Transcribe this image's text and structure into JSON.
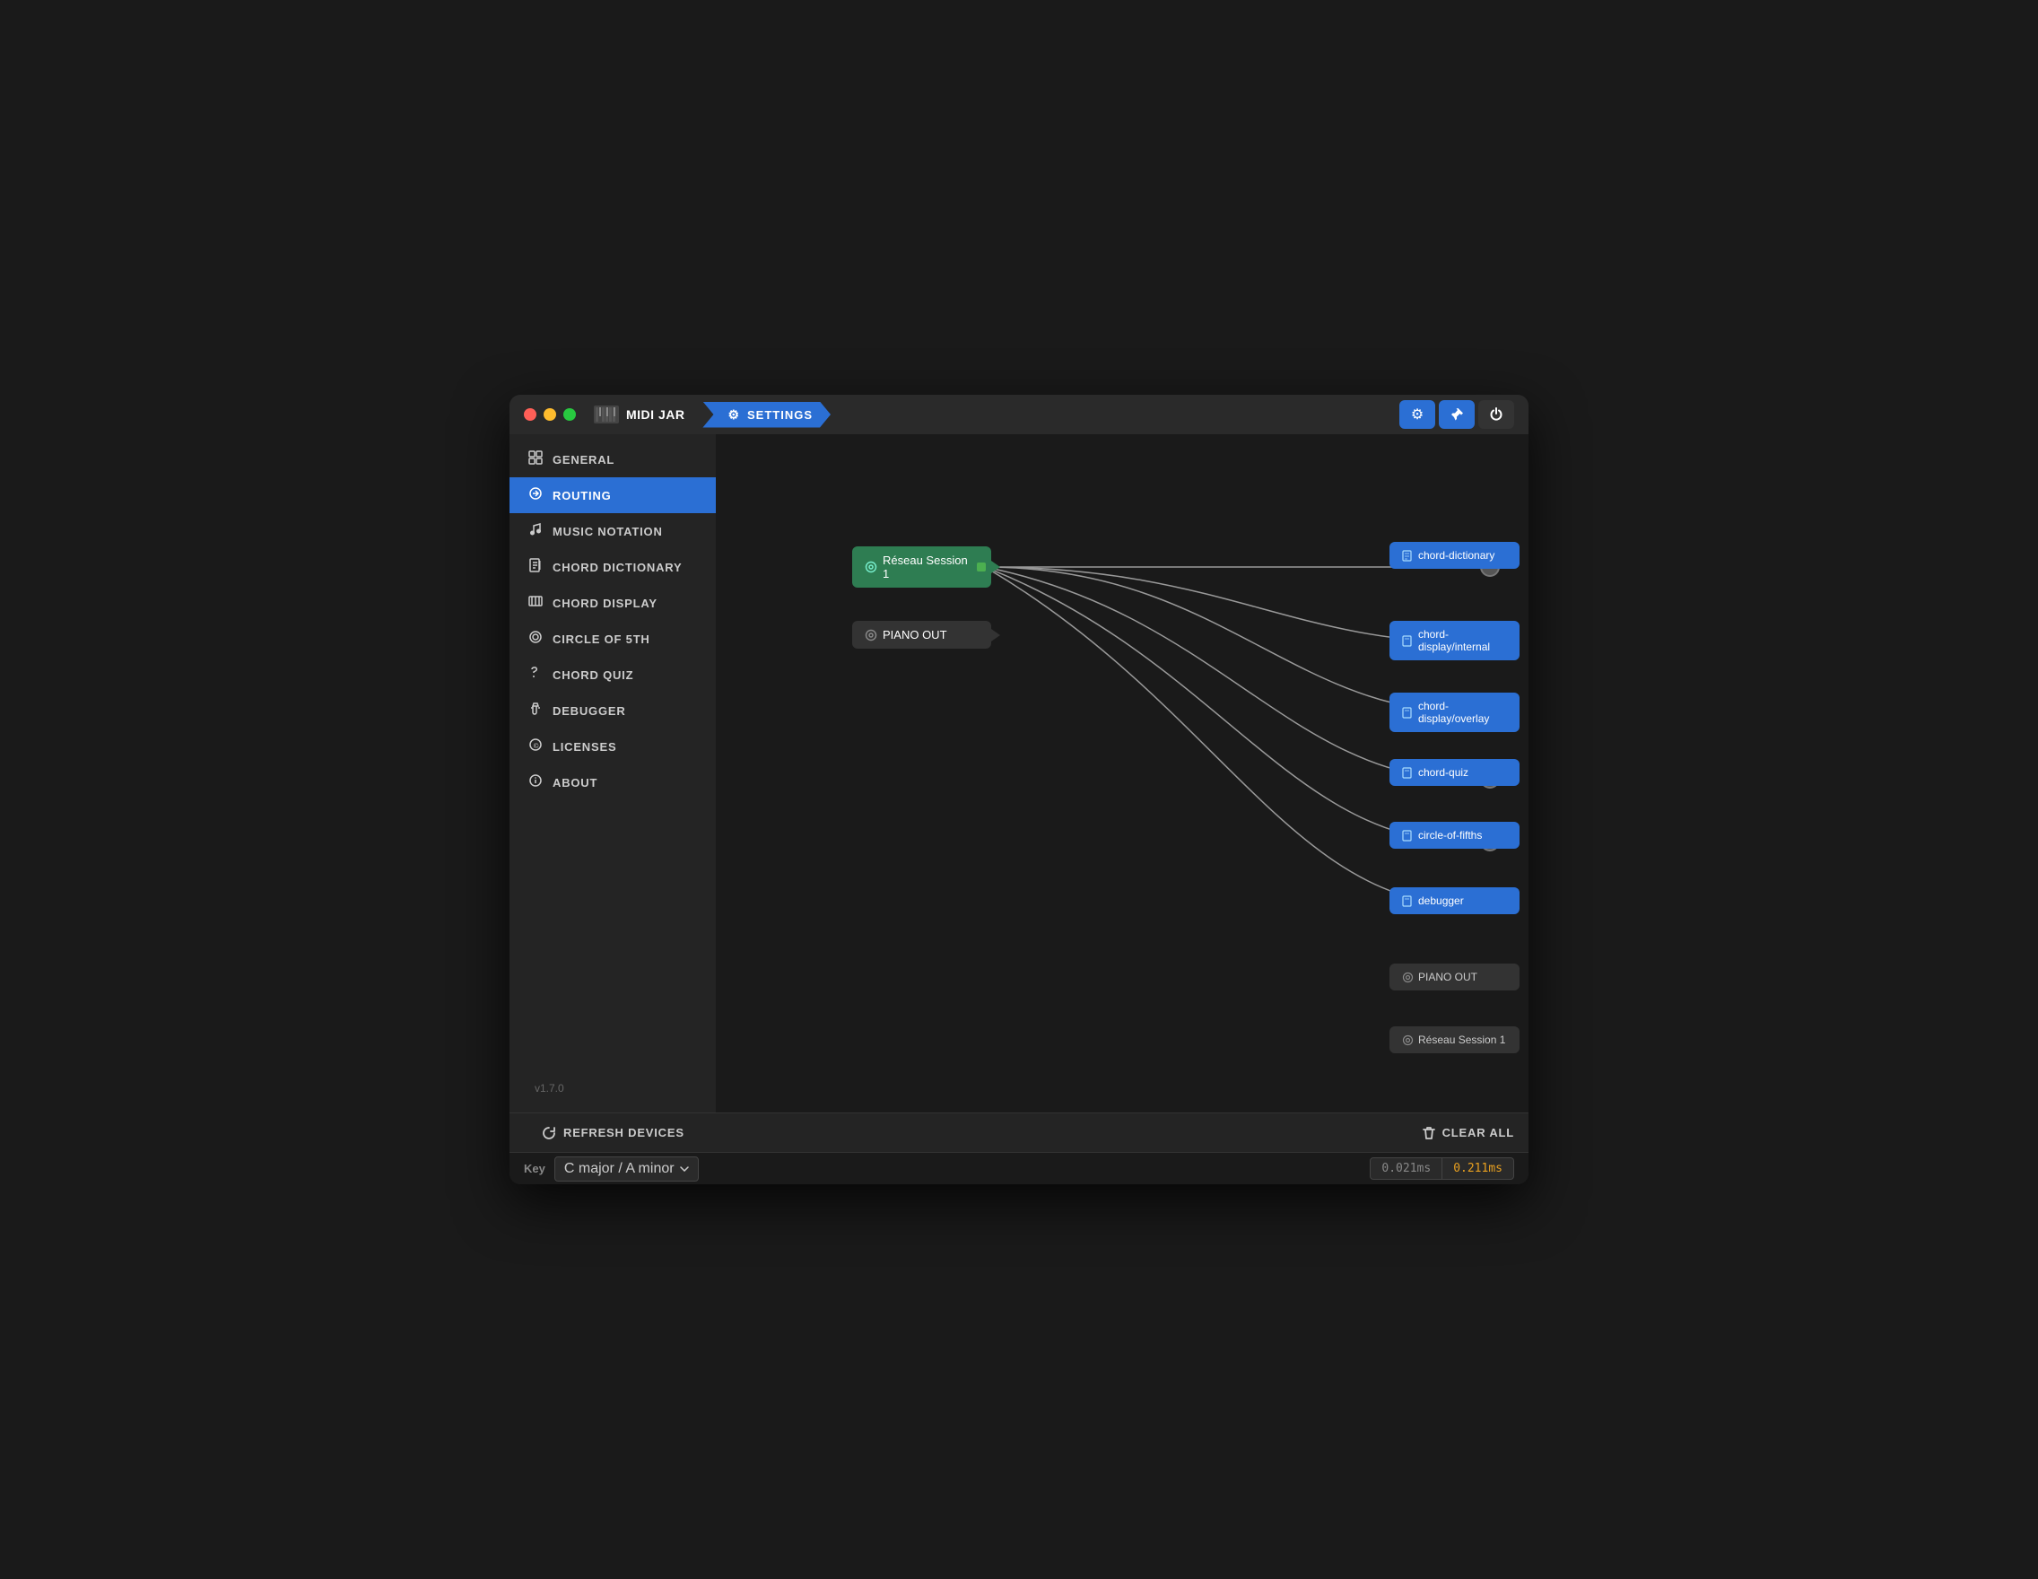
{
  "app": {
    "title": "MIDI JAR",
    "settings_tab": "SETTINGS",
    "version": "v1.7.0"
  },
  "titlebar": {
    "settings_icon": "⚙",
    "pin_icon": "📌",
    "power_icon": "⏻"
  },
  "sidebar": {
    "items": [
      {
        "id": "general",
        "label": "GENERAL",
        "icon": "▦"
      },
      {
        "id": "routing",
        "label": "ROUTING",
        "icon": "⟳",
        "active": true
      },
      {
        "id": "music-notation",
        "label": "MUSIC NOTATION",
        "icon": "♪"
      },
      {
        "id": "chord-dictionary",
        "label": "CHORD DICTIONARY",
        "icon": "📖"
      },
      {
        "id": "chord-display",
        "label": "CHORD DISPLAY",
        "icon": "⌨"
      },
      {
        "id": "circle-of-5th",
        "label": "CIRCLE OF 5TH",
        "icon": "◎"
      },
      {
        "id": "chord-quiz",
        "label": "CHORD QUIZ",
        "icon": "⟳"
      },
      {
        "id": "debugger",
        "label": "DEBUGGER",
        "icon": "⚙"
      },
      {
        "id": "licenses",
        "label": "LICENSES",
        "icon": "©"
      },
      {
        "id": "about",
        "label": "ABOUT",
        "icon": "ℹ"
      }
    ]
  },
  "routing": {
    "source_node": "Réseau Session 1",
    "source_node_icon": "◎",
    "device_node": "PIANO OUT",
    "device_node_icon": "◎",
    "destinations": [
      {
        "label": "chord-dictionary",
        "icon": "▦"
      },
      {
        "label": "chord-display/internal",
        "icon": "▦"
      },
      {
        "label": "chord-display/overlay",
        "icon": "▦"
      },
      {
        "label": "chord-quiz",
        "icon": "▦"
      },
      {
        "label": "circle-of-fifths",
        "icon": "▦"
      },
      {
        "label": "debugger",
        "icon": "▦"
      }
    ],
    "right_devices": [
      {
        "label": "PIANO OUT",
        "icon": "◎"
      },
      {
        "label": "Réseau Session 1",
        "icon": "◎"
      }
    ]
  },
  "bottom_bar": {
    "refresh_label": "REFRESH DEVICES",
    "refresh_icon": "↺",
    "clear_label": "CLEAR ALL",
    "clear_icon": "🗑"
  },
  "status_bar": {
    "key_label": "Key",
    "key_value": "C major / A minor",
    "timing_1": "0.021ms",
    "timing_2": "0.211ms"
  }
}
